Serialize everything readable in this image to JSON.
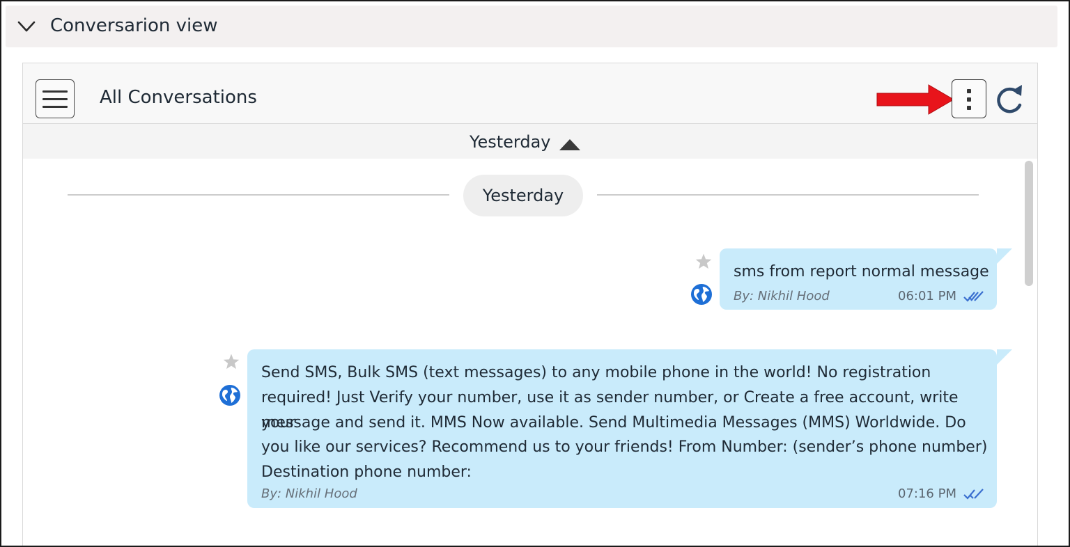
{
  "section": {
    "title": "Conversarion view",
    "chevron_icon": "chevron-down-icon"
  },
  "header": {
    "title": "All Conversations",
    "menu_icon": "hamburger-menu-icon",
    "more_icon": "more-vertical-icon",
    "refresh_icon": "refresh-icon",
    "annotation_color": "#e8141b"
  },
  "date_bar": {
    "label": "Yesterday",
    "caret_icon": "caret-up-icon"
  },
  "date_separator": {
    "label": "Yesterday"
  },
  "colors": {
    "bubble": "#c9ebfb",
    "globe": "#1e6fd6",
    "checks": "#3a6fcf",
    "star": "#c8c8c8"
  },
  "messages": [
    {
      "text": "sms from report normal message",
      "author": "By: Nikhil Hood",
      "time": "06:01 PM",
      "status_icon": "double-check-icon",
      "star_icon": "star-icon",
      "globe_icon": "globe-icon"
    },
    {
      "lines": [
        "Send SMS, Bulk SMS (text messages) to any mobile phone in the world! No registration",
        "required! Just Verify your number, use it as sender number, or Create a free account, write your",
        "message and send it. MMS Now available. Send Multimedia Messages (MMS) Worldwide. Do",
        "you like our services? Recommend us to your friends! From Number: (sender’s phone number)",
        "Destination phone number:"
      ],
      "author": "By: Nikhil Hood",
      "time": "07:16 PM",
      "status_icon": "double-check-icon",
      "star_icon": "star-icon",
      "globe_icon": "globe-icon"
    }
  ]
}
